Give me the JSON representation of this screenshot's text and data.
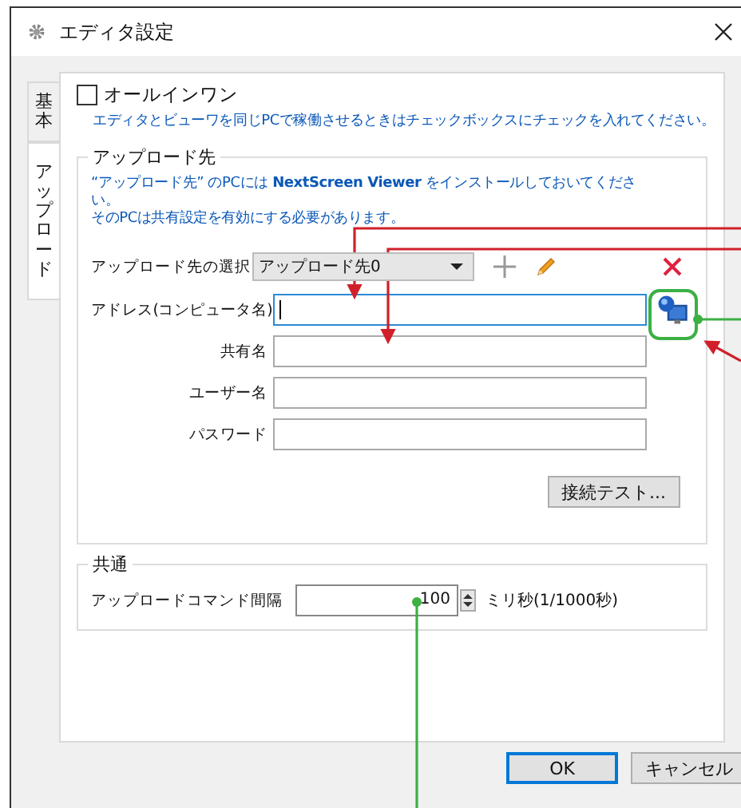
{
  "window": {
    "title": "エディタ設定"
  },
  "tabs": [
    {
      "label": "基本",
      "selected": false
    },
    {
      "label": "アップロード",
      "selected": true
    }
  ],
  "all_in_one": {
    "label": "オールインワン",
    "checked": false,
    "description": "エディタとビューワを同じPCで稼働させるときはチェックボックスにチェックを入れてください。"
  },
  "upload_group": {
    "title": "アップロード先",
    "notice_lines": [
      "“アップロード先” のPCには **NextScreen Viewer** をインストールしておいてくださ",
      "い。",
      "そのPCは共有設定を有効にする必要があります。"
    ],
    "select_label": "アップロード先の選択",
    "select_value": "アップロード先0",
    "fields": [
      {
        "label": "アドレス(コンピュータ名)",
        "focused": true
      },
      {
        "label": "共有名",
        "focused": false
      },
      {
        "label": "ユーザー名",
        "focused": false
      },
      {
        "label": "パスワード",
        "focused": false
      }
    ],
    "test_button": "接続テスト..."
  },
  "common_group": {
    "title": "共通",
    "interval_label": "アップロードコマンド間隔",
    "interval_value": "100",
    "unit": "ミリ秒(1/1000秒)"
  },
  "buttons": [
    {
      "label": "OK",
      "default": true
    },
    {
      "label": "キャンセル",
      "default": false
    }
  ]
}
